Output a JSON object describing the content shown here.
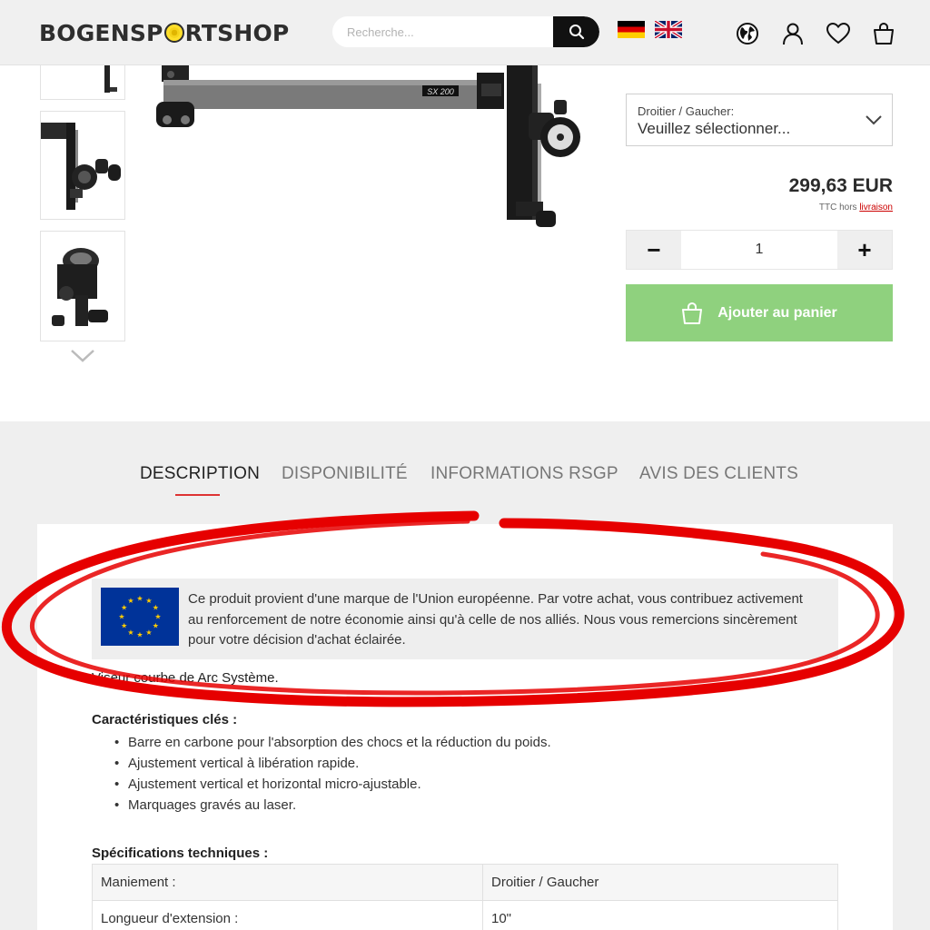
{
  "header": {
    "logo_left": "BOGENSP",
    "logo_right": "RTSHOP",
    "search_placeholder": "Recherche...",
    "icons": [
      "search-icon",
      "flag-de-icon",
      "flag-uk-icon",
      "globe-icon",
      "user-icon",
      "heart-icon",
      "bag-icon"
    ]
  },
  "product": {
    "image_badge": "SX 200",
    "variant": {
      "label": "Droitier / Gaucher:",
      "value": "Veuillez sélectionner..."
    },
    "price": "299,63 EUR",
    "tax_prefix": "TTC hors",
    "tax_link": "livraison",
    "quantity": "1",
    "qty_minus": "−",
    "qty_plus": "+",
    "add_to_cart": "Ajouter au panier"
  },
  "tabs": [
    {
      "label": "DESCRIPTION",
      "active": true
    },
    {
      "label": "DISPONIBILITÉ",
      "active": false
    },
    {
      "label": "INFORMATIONS RSGP",
      "active": false
    },
    {
      "label": "AVIS DES CLIENTS",
      "active": false
    }
  ],
  "description": {
    "eu_notice": "Ce produit provient d'une marque de l'Union européenne. Par votre achat, vous contribuez activement au renforcement de notre économie ainsi qu'à celle de nos alliés. Nous vous remercions sincèrement pour votre décision d'achat éclairée.",
    "intro": "Viseur courbe de Arc Système.",
    "features_title": "Caractéristiques clés :",
    "features": [
      "Barre en carbone pour l'absorption des chocs et la réduction du poids.",
      "Ajustement vertical à libération rapide.",
      "Ajustement vertical et horizontal micro-ajustable.",
      "Marquages gravés au laser."
    ],
    "specs_title": "Spécifications techniques :",
    "specs": [
      {
        "key": "Maniement :",
        "value": "Droitier / Gaucher"
      },
      {
        "key": "Longueur d'extension :",
        "value": "10\""
      }
    ]
  },
  "colors": {
    "accent_red": "#d33333",
    "cart_green": "#8fd17e",
    "eu_blue": "#003399",
    "eu_star": "#ffcc00"
  }
}
